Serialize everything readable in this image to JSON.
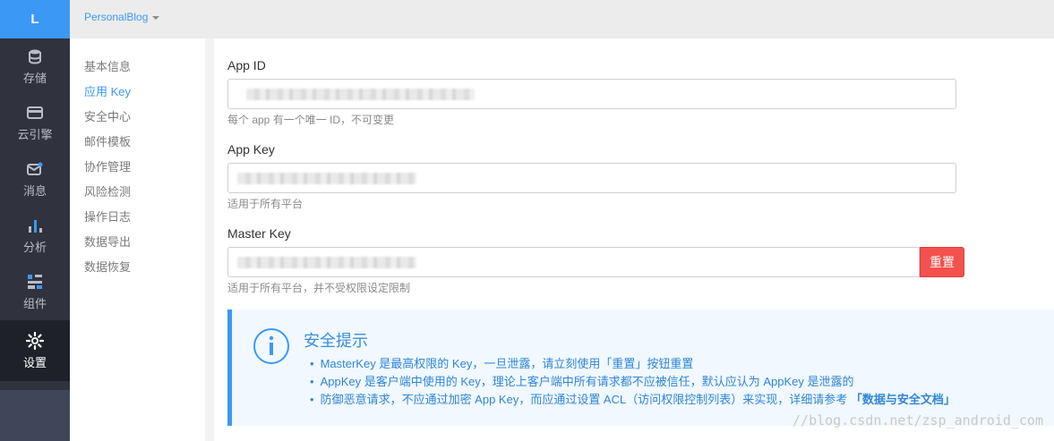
{
  "rail": {
    "logo": "L",
    "items": [
      {
        "label": "存储",
        "icon": "database-icon"
      },
      {
        "label": "云引擎",
        "icon": "engine-icon"
      },
      {
        "label": "消息",
        "icon": "message-icon"
      },
      {
        "label": "分析",
        "icon": "analytics-icon"
      },
      {
        "label": "组件",
        "icon": "components-icon"
      },
      {
        "label": "设置",
        "icon": "gear-icon"
      }
    ]
  },
  "topbar": {
    "app_name": "PersonalBlog"
  },
  "submenu": {
    "items": [
      {
        "label": "基本信息"
      },
      {
        "label": "应用 Key"
      },
      {
        "label": "安全中心"
      },
      {
        "label": "邮件模板"
      },
      {
        "label": "协作管理"
      },
      {
        "label": "风险检测"
      },
      {
        "label": "操作日志"
      },
      {
        "label": "数据导出"
      },
      {
        "label": "数据恢复"
      }
    ],
    "active": "应用 Key"
  },
  "fields": {
    "app_id": {
      "label": "App ID",
      "help": "每个 app 有一个唯一 ID，不可变更"
    },
    "app_key": {
      "label": "App Key",
      "help": "适用于所有平台"
    },
    "master_key": {
      "label": "Master Key",
      "help": "适用于所有平台，并不受权限设定限制",
      "reset_label": "重置"
    }
  },
  "tips": {
    "title": "安全提示",
    "items": [
      "MasterKey 是最高权限的 Key，一旦泄露，请立刻使用「重置」按钮重置",
      "AppKey 是客户端中使用的 Key，理论上客户端中所有请求都不应被信任，默认应认为 AppKey 是泄露的",
      "防御恶意请求，不应通过加密 App Key，而应通过设置 ACL（访问权限控制列表）来实现，详细请参考 "
    ],
    "link": "「数据与安全文档」"
  },
  "watermark": "//blog.csdn.net/zsp_android_com",
  "colors": {
    "accent": "#3b99f5",
    "danger": "#f2514d",
    "rail_bg": "#30333e"
  }
}
